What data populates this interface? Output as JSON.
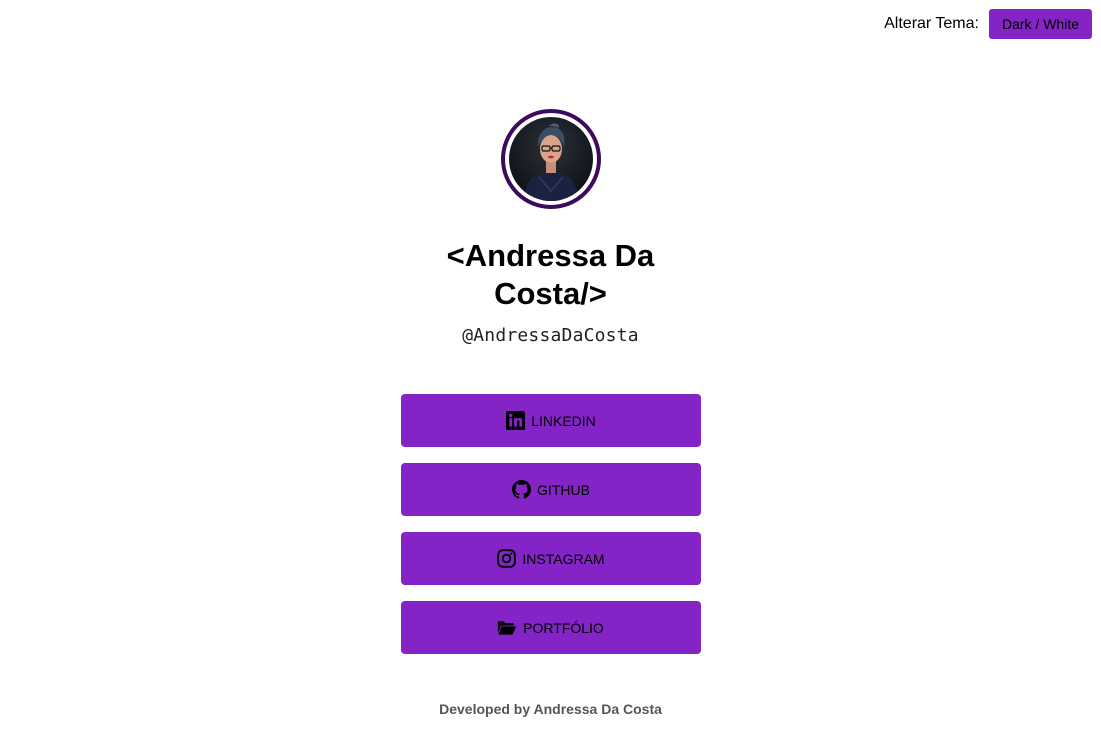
{
  "colors": {
    "accent": "#8424c6",
    "avatar_ring": "#3d0a5e",
    "background": "#ffffff",
    "footer_text": "#555555"
  },
  "theme": {
    "label": "Alterar Tema:",
    "button_label": "Dark / White"
  },
  "profile": {
    "name": "<Andressa Da Costa/>",
    "handle": "@AndressaDaCosta"
  },
  "links": [
    {
      "icon": "linkedin-icon",
      "label": "LINKEDIN"
    },
    {
      "icon": "github-icon",
      "label": "GITHUB"
    },
    {
      "icon": "instagram-icon",
      "label": "INSTAGRAM"
    },
    {
      "icon": "folder-open-icon",
      "label": "PORTFÓLIO"
    }
  ],
  "footer": {
    "text": "Developed by Andressa Da Costa"
  }
}
